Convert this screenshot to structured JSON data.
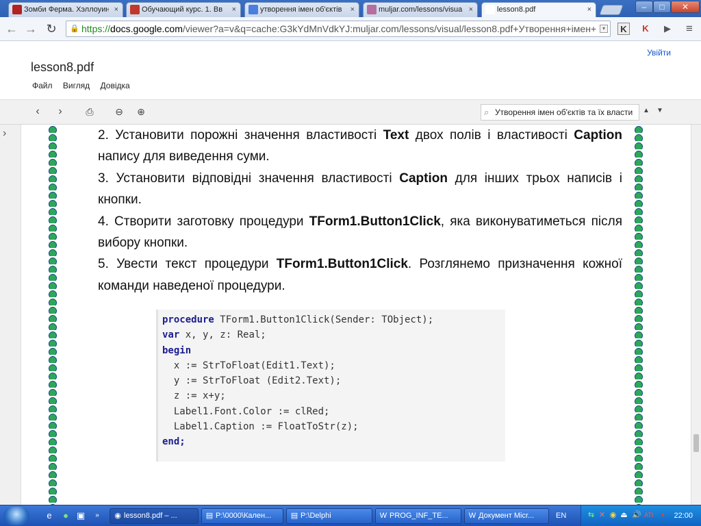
{
  "browser": {
    "tabs": [
      {
        "label": "Зомби Ферма. Хэллоуин",
        "icon": "game-favicon",
        "color": "#b22222"
      },
      {
        "label": "Обучающий курс. 1. Вв",
        "icon": "course-favicon",
        "color": "#c0392b"
      },
      {
        "label": "утворення імен об'єктів",
        "icon": "google-favicon",
        "color": "#4a7ee0"
      },
      {
        "label": "muljar.com/lessons/visua",
        "icon": "avatar-favicon",
        "color": "#b46ea0"
      },
      {
        "label": "lesson8.pdf",
        "icon": "document-favicon",
        "color": "#ffffff",
        "active": true
      }
    ],
    "window_controls": {
      "minimize": "–",
      "maximize": "□",
      "close": "✕"
    },
    "url": {
      "scheme": "https://",
      "domain": "docs.google.com",
      "path": "/viewer?a=v&q=cache:G3kYdMnVdkYJ:muljar.com/lessons/visual/lesson8.pdf+Утворення+імен+"
    },
    "extensions": [
      "K",
      "K",
      "▶"
    ],
    "menu_icon": "≡"
  },
  "docs": {
    "signin_label": "Увійти",
    "title": "lesson8.pdf",
    "menu": [
      "Файл",
      "Вигляд",
      "Довідка"
    ],
    "search_value": "Утворення імен об'єктів та їх власти"
  },
  "content": {
    "paragraphs": [
      {
        "parts": [
          {
            "t": "2. Установити порожні значення властивості "
          },
          {
            "t": "Text",
            "b": true
          },
          {
            "t": " двох полів і властивості "
          },
          {
            "t": "Caption",
            "b": true
          },
          {
            "t": " напису для виведення суми."
          }
        ]
      },
      {
        "parts": [
          {
            "t": "3. Установити відповідні значення властивості  "
          },
          {
            "t": "Caption",
            "b": true
          },
          {
            "t": " для інших трьох написів і кнопки."
          }
        ]
      },
      {
        "parts": [
          {
            "t": "4. Створити заготовку процедури "
          },
          {
            "t": "TForm1.Button1Click",
            "b": true
          },
          {
            "t": ", яка виконуватиметься після вибору кнопки."
          }
        ]
      },
      {
        "parts": [
          {
            "t": "5. Увести текст процедури "
          },
          {
            "t": "TForm1.Button1Click",
            "b": true
          },
          {
            "t": ". Розглянемо призначення кожної команди наведеної процедури."
          }
        ]
      }
    ],
    "code_lines": [
      [
        {
          "t": "procedure",
          "k": true
        },
        {
          "t": " TForm1.Button1Click(Sender: TObject);"
        }
      ],
      [
        {
          "t": "var",
          "k": true
        },
        {
          "t": " x, y, z: Real;"
        }
      ],
      [
        {
          "t": "begin",
          "k": true
        }
      ],
      [
        {
          "t": "  x := StrToFloat(Edit1.Text);"
        }
      ],
      [
        {
          "t": "  y := StrToFloat (Edit2.Text);"
        }
      ],
      [
        {
          "t": "  z := x+y;"
        }
      ],
      [
        {
          "t": "  Label1.Font.Color := clRed;"
        }
      ],
      [
        {
          "t": "  Label1.Caption := FloatToStr(z);"
        }
      ],
      [
        {
          "t": "end;",
          "k": true
        }
      ]
    ]
  },
  "taskbar": {
    "tasks": [
      {
        "label": "lesson8.pdf – ...",
        "icon": "chrome-icon",
        "active": true
      },
      {
        "label": "P:\\0000\\Кален...",
        "icon": "folder-icon"
      },
      {
        "label": "P:\\Delphi",
        "icon": "folder-icon"
      },
      {
        "label": "PROG_INF_TE...",
        "icon": "word-icon"
      },
      {
        "label": "Документ Micr...",
        "icon": "word-icon"
      }
    ],
    "language": "EN",
    "clock": "22:00"
  }
}
